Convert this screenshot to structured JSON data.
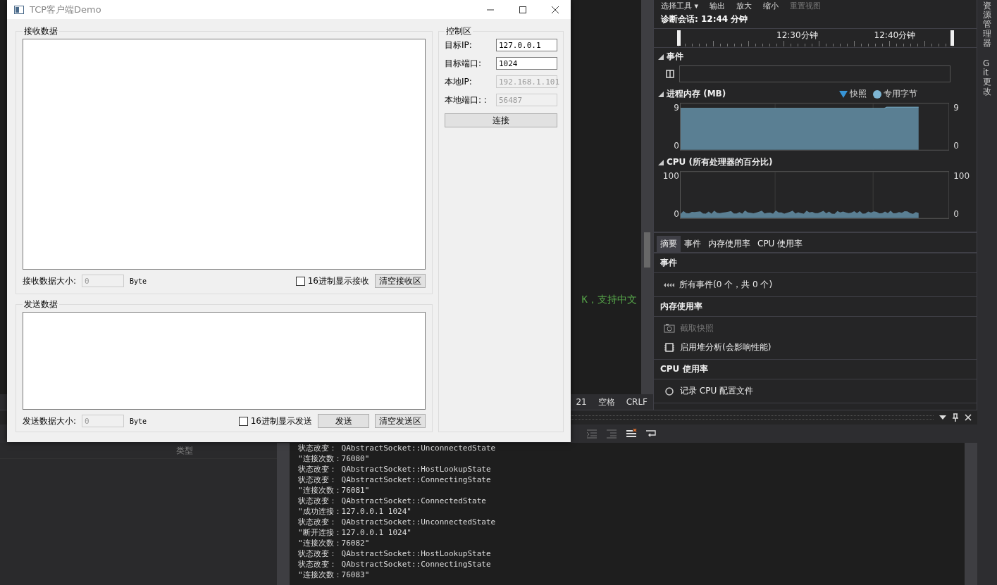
{
  "qt_window": {
    "title": "TCP客户端Demo",
    "receive_group": {
      "title": "接收数据",
      "size_label": "接收数据大小:",
      "size_value": "0",
      "unit": "Byte",
      "hex_checkbox": {
        "label": "16进制显示接收",
        "checked": false
      },
      "clear_button": "清空接收区"
    },
    "send_group": {
      "title": "发送数据",
      "size_label": "发送数据大小:",
      "size_value": "0",
      "unit": "Byte",
      "hex_checkbox": {
        "label": "16进制显示发送",
        "checked": false
      },
      "send_button": "发送",
      "clear_button": "清空发送区"
    },
    "control_group": {
      "title": "控制区",
      "fields": [
        {
          "label": "目标IP:",
          "value": "127.0.0.1",
          "disabled": false
        },
        {
          "label": "目标端口:",
          "value": "1024",
          "disabled": false
        },
        {
          "label": "本地IP:",
          "value": "192.168.1.101",
          "disabled": true
        },
        {
          "label": "本地端口: :",
          "value": "56487",
          "disabled": true
        }
      ],
      "connect_button": "连接"
    }
  },
  "editor": {
    "code_fragment": "K，支持中文",
    "status_bar": [
      "21",
      "空格",
      "CRLF"
    ]
  },
  "diagnostics": {
    "toolbar": [
      "选择工具 ▾",
      "输出",
      "放大",
      "缩小",
      "重置视图"
    ],
    "session": "诊断会话: 12:44 分钟",
    "timeline_labels": [
      "12:30分钟",
      "12:40分钟"
    ],
    "events_title": "事件",
    "memory": {
      "title": "进程内存 (MB)",
      "legend": [
        {
          "label": "快照",
          "kind": "triangle"
        },
        {
          "label": "专用字节",
          "kind": "dot"
        }
      ],
      "left_axis": [
        "9",
        "0"
      ],
      "right_axis": [
        "9",
        "0"
      ]
    },
    "cpu": {
      "title": "CPU (所有处理器的百分比)",
      "left_axis": [
        "100",
        "0"
      ],
      "right_axis": [
        "100",
        "0"
      ]
    },
    "tabs": [
      {
        "label": "摘要",
        "selected": true
      },
      {
        "label": "事件",
        "selected": false
      },
      {
        "label": "内存使用率",
        "selected": false
      },
      {
        "label": "CPU 使用率",
        "selected": false
      }
    ],
    "sections": [
      {
        "title": "事件",
        "items": [
          {
            "label": "所有事件(0 个，共 0 个)",
            "kind": "events",
            "disabled": false
          }
        ]
      },
      {
        "title": "内存使用率",
        "items": [
          {
            "label": "截取快照",
            "kind": "camera",
            "disabled": true
          },
          {
            "label": "启用堆分析(会影响性能)",
            "kind": "heap",
            "disabled": false
          }
        ]
      },
      {
        "title": "CPU 使用率",
        "items": [
          {
            "label": "记录 CPU 配置文件",
            "kind": "record",
            "disabled": false
          }
        ]
      }
    ]
  },
  "side_tabs": [
    "资源管理器",
    "Git 更改"
  ],
  "output_panel": {
    "column_header": "类型",
    "lines": [
      "状态改变： QAbstractSocket::UnconnectedState",
      "\"连接次数：76080\"",
      "状态改变： QAbstractSocket::HostLookupState",
      "状态改变： QAbstractSocket::ConnectingState",
      "\"连接次数：76081\"",
      "状态改变： QAbstractSocket::ConnectedState",
      "\"成功连接：127.0.0.1 1024\"",
      "状态改变： QAbstractSocket::UnconnectedState",
      "\"断开连接：127.0.0.1 1024\"",
      "\"连接次数：76082\"",
      "状态改变： QAbstractSocket::HostLookupState",
      "状态改变： QAbstractSocket::ConnectingState",
      "\"连接次数：76083\""
    ]
  }
}
